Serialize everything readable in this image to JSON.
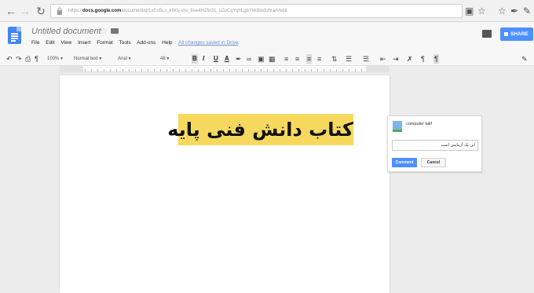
{
  "browser": {
    "url_scheme": "https://",
    "url_host": "docs.google.com",
    "url_path": "/document/d/1xEu5Ls_kWzj-vre_8se4HZ5r31_uZuCqYqhLgbYkk5leduhraA/edit"
  },
  "doc": {
    "title": "Untitled document",
    "menu": [
      "File",
      "Edit",
      "View",
      "Insert",
      "Format",
      "Tools",
      "Add-ons",
      "Help"
    ],
    "saved_status": "All changes saved in Drive",
    "share_label": "SHARE"
  },
  "toolbar": {
    "zoom": "100%",
    "style": "Normal text",
    "font": "Arial",
    "size": "48",
    "bold": "B",
    "italic": "I",
    "underline": "U",
    "text_color": "A"
  },
  "page": {
    "highlighted_text": "کتاب دانش فنی پایه"
  },
  "comment": {
    "user": "computer talif",
    "text": "این یک آزمایش است",
    "comment_button": "Comment",
    "cancel_button": "Cancel"
  },
  "colors": {
    "highlight": "#f6d85f",
    "share": "#4d90fe"
  }
}
